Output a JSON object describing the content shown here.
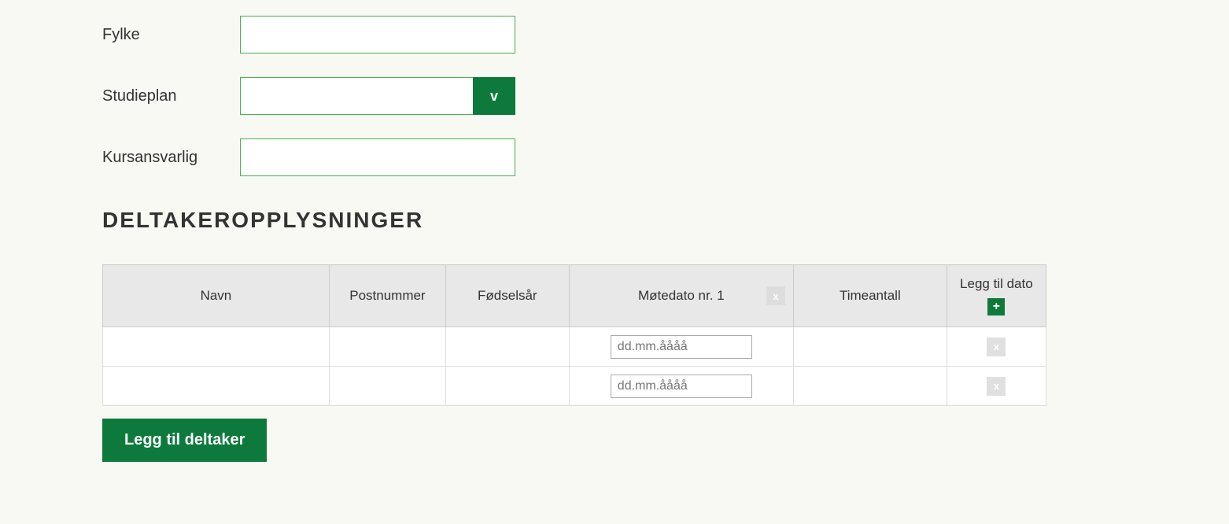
{
  "form": {
    "fylke": {
      "label": "Fylke",
      "value": ""
    },
    "studieplan": {
      "label": "Studieplan",
      "value": "",
      "toggle": "v"
    },
    "kursansvarlig": {
      "label": "Kursansvarlig",
      "value": ""
    }
  },
  "section_heading": "DELTAKEROPPLYSNINGER",
  "table": {
    "headers": {
      "navn": "Navn",
      "postnummer": "Postnummer",
      "fodselsaar": "Fødselsår",
      "motedato": "Møtedato nr. 1",
      "timeantall": "Timeantall",
      "leggtil": "Legg til dato"
    },
    "remove_date_icon": "x",
    "add_date_icon": "+",
    "remove_row_icon": "x",
    "date_placeholder": "dd.mm.åååå",
    "rows": [
      {
        "navn": "",
        "postnummer": "",
        "fodselsaar": "",
        "motedato": "",
        "timeantall": ""
      },
      {
        "navn": "",
        "postnummer": "",
        "fodselsaar": "",
        "motedato": "",
        "timeantall": ""
      }
    ]
  },
  "buttons": {
    "add_participant": "Legg til deltaker"
  }
}
